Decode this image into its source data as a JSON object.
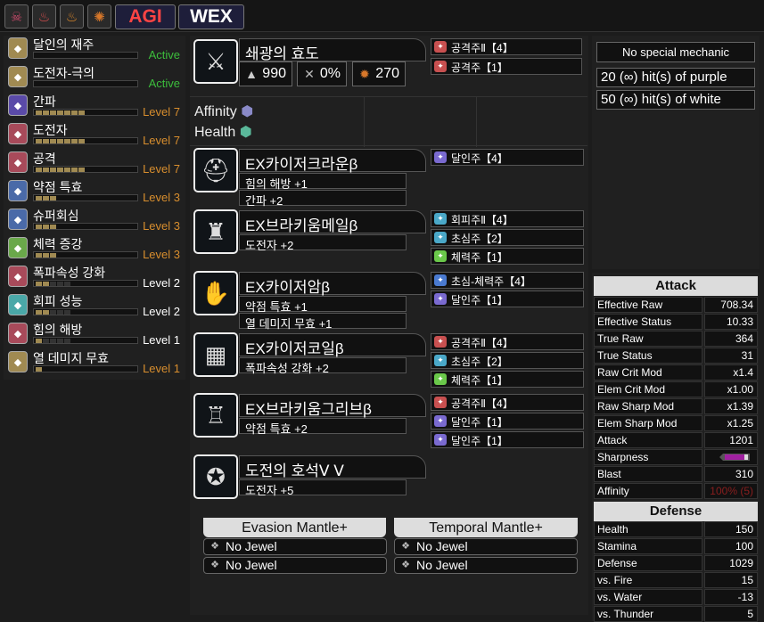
{
  "topbar": {
    "icons": [
      {
        "name": "poison-icon",
        "glyph": "☠",
        "color": "#c84a6a"
      },
      {
        "name": "paralysis-icon",
        "glyph": "♨",
        "color": "#e05050"
      },
      {
        "name": "sleep-icon",
        "glyph": "♨",
        "color": "#e08a2a"
      },
      {
        "name": "blast-icon",
        "glyph": "✺",
        "color": "#d8782a"
      }
    ],
    "tags": [
      "AGI",
      "WEX"
    ],
    "tag_colors": {
      "AGI": "#ff4444",
      "WEX": "#ffffff"
    }
  },
  "skills": [
    {
      "name": "달인의 재주",
      "level": "Active",
      "level_color": "green",
      "pips": 0,
      "max": 0,
      "icon_color": "#a08a52"
    },
    {
      "name": "도전자-극의",
      "level": "Active",
      "level_color": "green",
      "pips": 0,
      "max": 0,
      "icon_color": "#a08a52"
    },
    {
      "name": "간파",
      "level": "Level 7",
      "level_color": "orange",
      "pips": 7,
      "max": 7,
      "icon_color": "#5a4aa8"
    },
    {
      "name": "도전자",
      "level": "Level 7",
      "level_color": "orange",
      "pips": 7,
      "max": 7,
      "icon_color": "#a84a5a"
    },
    {
      "name": "공격",
      "level": "Level 7",
      "level_color": "orange",
      "pips": 7,
      "max": 7,
      "icon_color": "#a84a5a"
    },
    {
      "name": "약점 특효",
      "level": "Level 3",
      "level_color": "orange",
      "pips": 3,
      "max": 3,
      "icon_color": "#4a6aa8"
    },
    {
      "name": "슈퍼회심",
      "level": "Level 3",
      "level_color": "orange",
      "pips": 3,
      "max": 3,
      "icon_color": "#4a6aa8"
    },
    {
      "name": "체력 증강",
      "level": "Level 3",
      "level_color": "orange",
      "pips": 3,
      "max": 3,
      "icon_color": "#6aa84a"
    },
    {
      "name": "폭파속성 강화",
      "level": "Level 2",
      "level_color": "white",
      "pips": 2,
      "max": 5,
      "icon_color": "#a84a5a"
    },
    {
      "name": "회피 성능",
      "level": "Level 2",
      "level_color": "white",
      "pips": 2,
      "max": 5,
      "icon_color": "#4aa8a8"
    },
    {
      "name": "힘의 해방",
      "level": "Level 1",
      "level_color": "white",
      "pips": 1,
      "max": 5,
      "icon_color": "#a84a5a"
    },
    {
      "name": "열 데미지 무효",
      "level": "Level 1",
      "level_color": "orange",
      "pips": 1,
      "max": 1,
      "icon_color": "#a08a52"
    }
  ],
  "weapon": {
    "name": "쇄광의 효도",
    "attack": "990",
    "affinity": "0%",
    "element": "270",
    "affinity_label": "Affinity",
    "health_label": "Health",
    "decos": [
      {
        "label": "공격주Ⅱ【4】",
        "color": "#c85050"
      },
      {
        "label": "공격주【1】",
        "color": "#c85050"
      }
    ]
  },
  "armor": [
    {
      "name": "EX카이저크라운β",
      "glyph": "⛑",
      "skills": [
        "힘의 해방 +1",
        "간파 +2"
      ],
      "decos": [
        {
          "label": "달인주【4】",
          "color": "#7a6ad0"
        }
      ]
    },
    {
      "name": "EX브라키움메일β",
      "glyph": "♜",
      "skills": [
        "도전자 +2"
      ],
      "decos": [
        {
          "label": "회피주Ⅱ【4】",
          "color": "#4aa8c8"
        },
        {
          "label": "초심주【2】",
          "color": "#4aa8c8"
        },
        {
          "label": "체력주【1】",
          "color": "#6ac84a"
        }
      ]
    },
    {
      "name": "EX카이저암β",
      "glyph": "✋",
      "skills": [
        "약점 특효 +1",
        "열 데미지 무효 +1"
      ],
      "decos": [
        {
          "label": "초심-체력주【4】",
          "color": "#4a7ad0"
        },
        {
          "label": "달인주【1】",
          "color": "#7a6ad0"
        }
      ]
    },
    {
      "name": "EX카이저코일β",
      "glyph": "▦",
      "skills": [
        "폭파속성 강화 +2"
      ],
      "decos": [
        {
          "label": "공격주Ⅱ【4】",
          "color": "#c85050"
        },
        {
          "label": "초심주【2】",
          "color": "#4aa8c8"
        },
        {
          "label": "체력주【1】",
          "color": "#6ac84a"
        }
      ]
    },
    {
      "name": "EX브라키움그리브β",
      "glyph": "♖",
      "skills": [
        "약점 특효 +2"
      ],
      "decos": [
        {
          "label": "공격주Ⅱ【4】",
          "color": "#c85050"
        },
        {
          "label": "달인주【1】",
          "color": "#7a6ad0"
        },
        {
          "label": "달인주【1】",
          "color": "#7a6ad0"
        }
      ]
    },
    {
      "name": "도전의 호석Ⅴ Ⅴ",
      "glyph": "✪",
      "skills": [
        "도전자 +5"
      ],
      "decos": []
    }
  ],
  "mantles": [
    {
      "name": "Evasion Mantle+",
      "jewels": [
        "No Jewel",
        "No Jewel"
      ]
    },
    {
      "name": "Temporal Mantle+",
      "jewels": [
        "No Jewel",
        "No Jewel"
      ]
    }
  ],
  "mechanic": {
    "title": "No special mechanic",
    "lines": [
      "20 (∞) hit(s) of purple",
      "50 (∞) hit(s) of white"
    ]
  },
  "attack": {
    "header": "Attack",
    "rows": [
      {
        "k": "Effective Raw",
        "v": "708.34"
      },
      {
        "k": "Effective Status",
        "v": "10.33"
      },
      {
        "k": "True Raw",
        "v": "364"
      },
      {
        "k": "True Status",
        "v": "31"
      },
      {
        "k": "Raw Crit Mod",
        "v": "x1.4"
      },
      {
        "k": "Elem Crit Mod",
        "v": "x1.00"
      },
      {
        "k": "Raw Sharp Mod",
        "v": "x1.39"
      },
      {
        "k": "Elem Sharp Mod",
        "v": "x1.25"
      },
      {
        "k": "Attack",
        "v": "1201"
      },
      {
        "k": "Sharpness",
        "v": ""
      },
      {
        "k": "Blast",
        "v": "310"
      },
      {
        "k": "Affinity",
        "v": "100% (5)",
        "v_color": "#8a1e1e"
      }
    ]
  },
  "defense": {
    "header": "Defense",
    "rows": [
      {
        "k": "Health",
        "v": "150"
      },
      {
        "k": "Stamina",
        "v": "100"
      },
      {
        "k": "Defense",
        "v": "1029"
      },
      {
        "k": "vs. Fire",
        "v": "15"
      },
      {
        "k": "vs. Water",
        "v": "-13"
      },
      {
        "k": "vs. Thunder",
        "v": "5"
      }
    ]
  },
  "colors": {
    "affinity_hex": "#8a8ac8",
    "health_hex": "#5ab89a",
    "sharp_purple": "#a020a0"
  }
}
